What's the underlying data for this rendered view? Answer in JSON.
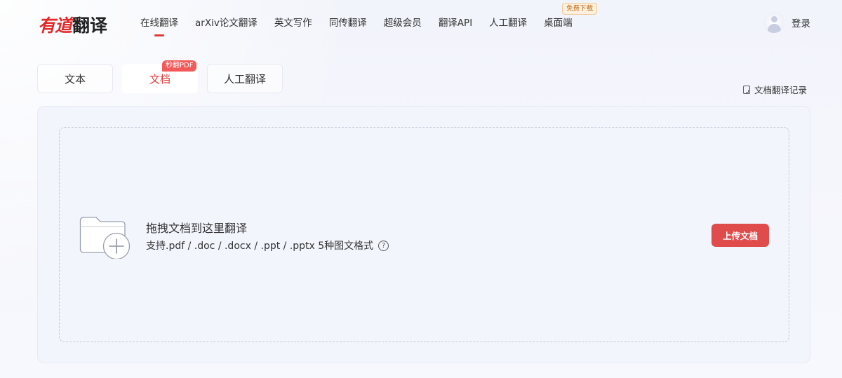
{
  "logo": {
    "part1": "有道",
    "part2": "翻译"
  },
  "nav": {
    "items": [
      {
        "label": "在线翻译",
        "active": true
      },
      {
        "label": "arXiv论文翻译"
      },
      {
        "label": "英文写作"
      },
      {
        "label": "同传翻译"
      },
      {
        "label": "超级会员"
      },
      {
        "label": "翻译API"
      },
      {
        "label": "人工翻译"
      },
      {
        "label": "桌面端",
        "badge": "免费下载"
      }
    ]
  },
  "login": {
    "label": "登录"
  },
  "tabs": [
    {
      "label": "文本"
    },
    {
      "label": "文档",
      "selected": true,
      "badge": "秒翻PDF"
    },
    {
      "label": "人工翻译"
    }
  ],
  "history": {
    "label": "文档翻译记录",
    "icon": "document-icon"
  },
  "upload": {
    "title": "拖拽文档到这里翻译",
    "subtitle": "支持.pdf / .doc / .docx / .ppt / .pptx 5种图文格式",
    "help_icon": "?",
    "button_label": "上传文档"
  },
  "colors": {
    "accent": "#e23b3b",
    "button": "#e04b4b",
    "badge": "#f25a5a"
  }
}
